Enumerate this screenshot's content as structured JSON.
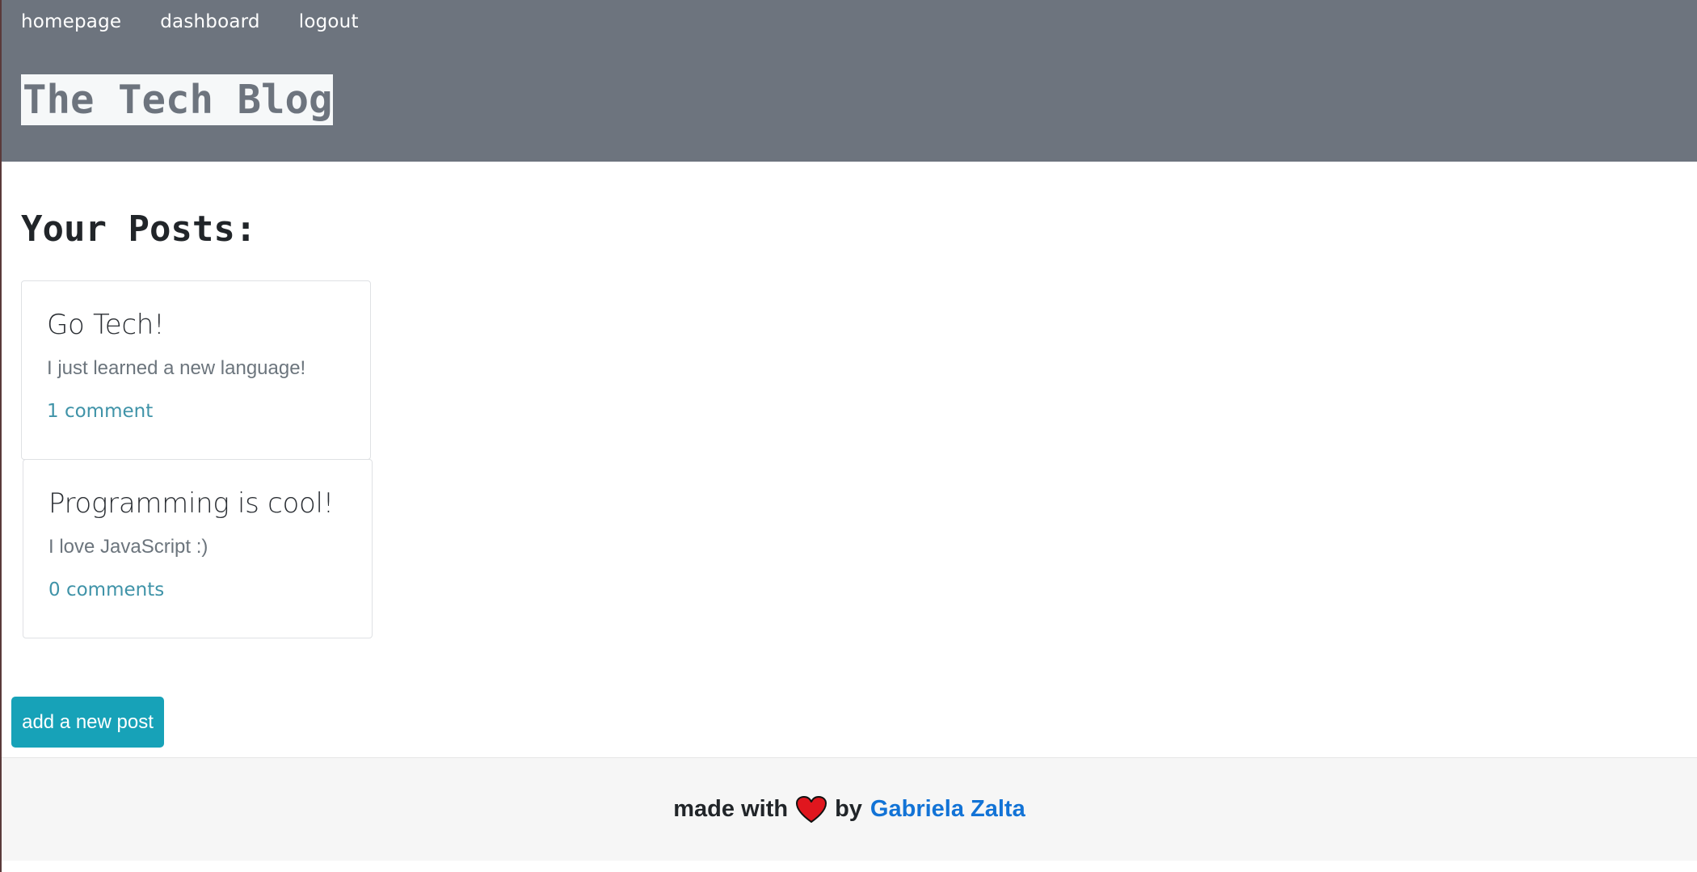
{
  "nav": {
    "items": [
      {
        "label": "homepage"
      },
      {
        "label": "dashboard"
      },
      {
        "label": "logout"
      }
    ]
  },
  "header": {
    "title": "The Tech Blog"
  },
  "main": {
    "heading": "Your Posts:",
    "posts": [
      {
        "title": "Go Tech!",
        "body": "I just learned a new language!",
        "comments": "1 comment"
      },
      {
        "title": "Programming is cool!",
        "body": "I love JavaScript :)",
        "comments": "0 comments"
      }
    ],
    "add_button_label": "add a new post"
  },
  "footer": {
    "prefix": "made with",
    "icon": "heart-icon",
    "by": "by",
    "author": "Gabriela Zalta",
    "heart_color": "#e0161e",
    "link_color": "#1273d6"
  },
  "colors": {
    "header_bg": "#6d747e",
    "button_bg": "#17a2b8",
    "comment_link": "#3f93a8"
  }
}
